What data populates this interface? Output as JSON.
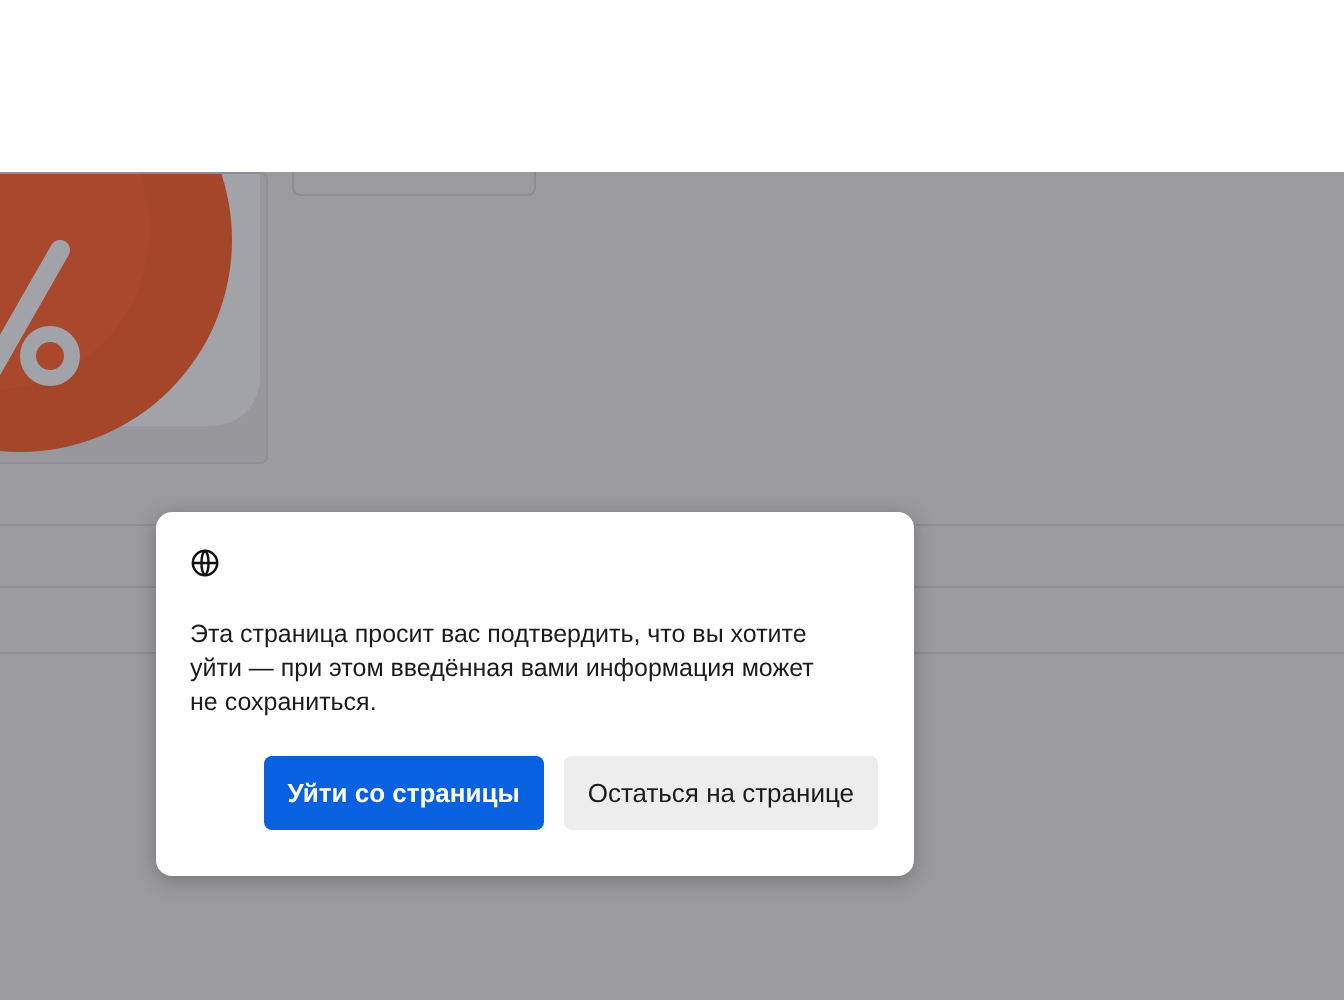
{
  "dialog": {
    "message": "Эта страница просит вас подтвердить, что вы хотите уйти — при этом введённая вами информация может не сохраниться.",
    "buttons": [
      {
        "label": "Уйти со страницы",
        "kind": "primary"
      },
      {
        "label": "Остаться на странице",
        "kind": "secondary"
      }
    ]
  }
}
